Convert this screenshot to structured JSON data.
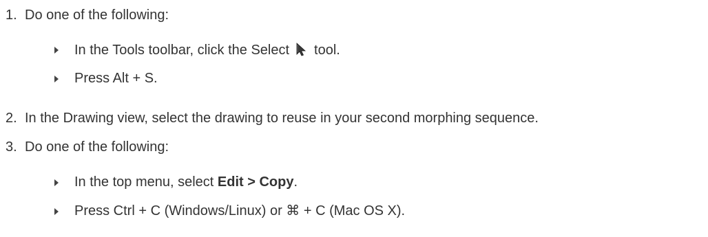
{
  "steps": [
    {
      "number": "1.",
      "text": "Do one of the following:",
      "substeps": [
        {
          "before": "In the Tools toolbar, click the Select",
          "icon": "select-arrow-icon",
          "after": "tool."
        },
        {
          "text": "Press Alt + S."
        }
      ]
    },
    {
      "number": "2.",
      "text": "In the Drawing view, select the drawing to reuse in your second morphing sequence."
    },
    {
      "number": "3.",
      "text": "Do one of the following:",
      "substeps": [
        {
          "before": "In the top menu, select ",
          "bold": "Edit > Copy",
          "after": "."
        },
        {
          "text": "Press Ctrl + C (Windows/Linux) or ⌘ + C (Mac OS X)."
        }
      ]
    }
  ]
}
